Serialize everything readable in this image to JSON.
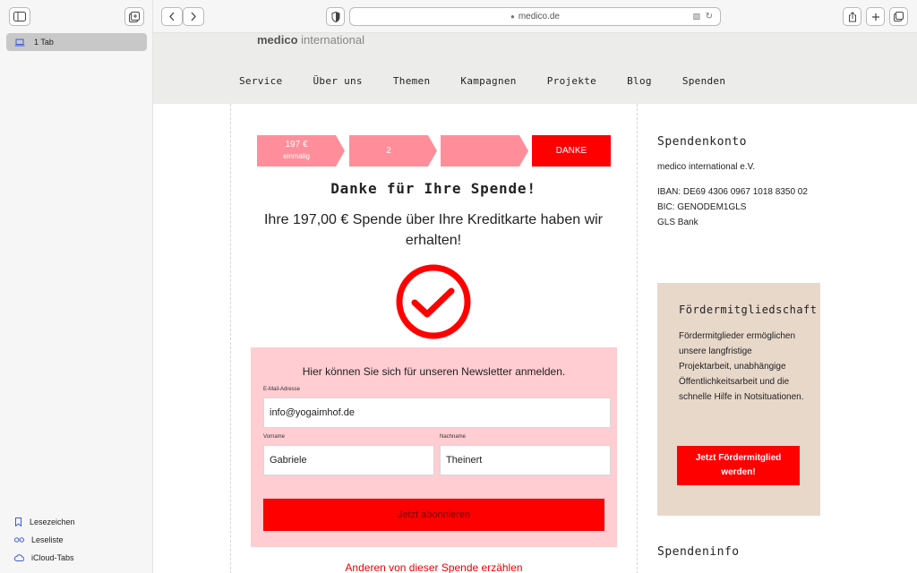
{
  "browser": {
    "url": "medico.de",
    "sidebar": {
      "tab_group": "1 Tab",
      "bookmarks": "Lesezeichen",
      "reading_list": "Leseliste",
      "icloud_tabs": "iCloud-Tabs"
    }
  },
  "site": {
    "logo_bold": "medico",
    "logo_rest": "international",
    "nav": [
      "Service",
      "Über uns",
      "Themen",
      "Kampagnen",
      "Projekte",
      "Blog",
      "Spenden"
    ]
  },
  "steps": [
    {
      "line1": "197 €",
      "line2": "einmalig",
      "color": "#ff8e9a"
    },
    {
      "line1": "2",
      "line2": "",
      "color": "#ff8e9a"
    },
    {
      "line1": "",
      "line2": "",
      "color": "#ff8e9a"
    },
    {
      "line1": "DANKE",
      "line2": "",
      "color": "#ff0000"
    }
  ],
  "confirmation": {
    "title": "Danke für Ihre Spende!",
    "message": "Ihre 197,00 € Spende über Ihre Kreditkarte haben wir erhalten!"
  },
  "newsletter": {
    "title": "Hier können Sie sich für unseren Newsletter anmelden.",
    "email_label": "E-Mail-Adresse",
    "email_value": "info@yogaimhof.de",
    "firstname_label": "Vorname",
    "firstname_value": "Gabriele",
    "lastname_label": "Nachname",
    "lastname_value": "Theinert",
    "subscribe_label": "Jetzt abonnieren"
  },
  "share_link": "Anderen von dieser Spende erzählen",
  "account": {
    "title": "Spendenkonto",
    "holder": "medico international e.V.",
    "iban": "IBAN: DE69 4306 0967 1018 8350 02",
    "bic": "BIC: GENODEM1GLS",
    "bank": "GLS Bank"
  },
  "membership": {
    "title": "Fördermitgliedschaft",
    "text": "Fördermitglieder ermöglichen unsere langfristige Projektarbeit, unabhängige Öffentlichkeitsarbeit und die schnelle Hilfe in Notsituationen.",
    "button": "Jetzt Fördermitglied werden!"
  },
  "info_title": "Spendeninfo",
  "colors": {
    "accent": "#ff0000",
    "pink": "#ffcdd2",
    "beige": "#e7d8ca"
  }
}
